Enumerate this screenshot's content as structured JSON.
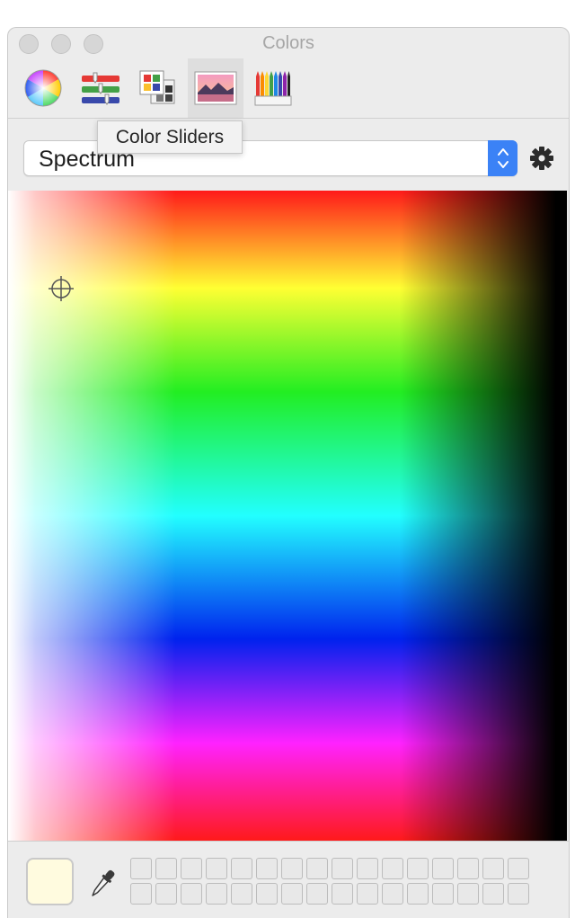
{
  "window": {
    "title": "Colors"
  },
  "toolbar": {
    "modes": [
      {
        "id": "color-wheel",
        "icon": "color-wheel-icon",
        "active": false
      },
      {
        "id": "color-sliders",
        "icon": "color-sliders-icon",
        "active": false
      },
      {
        "id": "color-palettes",
        "icon": "color-palettes-icon",
        "active": false
      },
      {
        "id": "image-palettes",
        "icon": "image-palettes-icon",
        "active": true
      },
      {
        "id": "pencils",
        "icon": "pencils-icon",
        "active": false
      }
    ],
    "tooltip": "Color Sliders"
  },
  "palette_popup": {
    "selected": "Spectrum"
  },
  "colors": {
    "accent": "#3b82f6",
    "current_color": "#fffbdf"
  }
}
